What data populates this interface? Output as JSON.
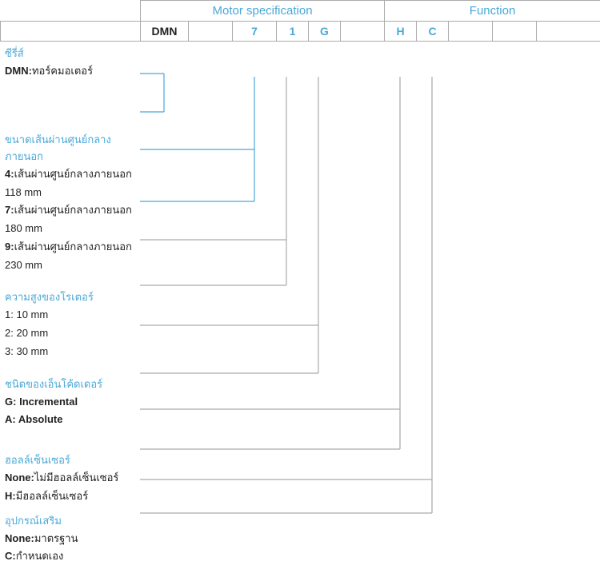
{
  "header": {
    "motor_spec_label": "Motor specification",
    "function_label": "Function",
    "codes": {
      "DMN": "DMN",
      "blank1": "",
      "seven": "7",
      "one": "1",
      "G": "G",
      "blank2": "",
      "H": "H",
      "C": "C",
      "blank3": "",
      "blank4": ""
    }
  },
  "sections": {
    "series": {
      "title": "ซีรี่ส์",
      "items": [
        {
          "label": "DMN:",
          "text": "ทอร์คมอเตอร์"
        }
      ]
    },
    "diameter": {
      "title": "ขนาดเส้นผ่านศูนย์กลางภายนอก",
      "items": [
        {
          "label": "4:",
          "text": "เส้นผ่านศูนย์กลางภายนอก 118 mm"
        },
        {
          "label": "7:",
          "text": "เส้นผ่านศูนย์กลางภายนอก 180 mm"
        },
        {
          "label": "9:",
          "text": "เส้นผ่านศูนย์กลางภายนอก 230 mm"
        }
      ]
    },
    "rotor_height": {
      "title": "ความสูงของโรเตอร์",
      "items": [
        {
          "label": "1:",
          "text": "10 mm"
        },
        {
          "label": "2:",
          "text": "20 mm"
        },
        {
          "label": "3:",
          "text": "30 mm"
        }
      ]
    },
    "encoder": {
      "title": "ชนิดของเอ็นโค้ดเดอร์",
      "items": [
        {
          "label": "G:",
          "text": "Incremental"
        },
        {
          "label": "A:",
          "text": "Absolute"
        }
      ]
    },
    "hall_sensor": {
      "title": "ฮอลล์เซ็นเซอร์",
      "items": [
        {
          "label": "None:",
          "text": "ไม่มีฮอลล์เซ็นเซอร์"
        },
        {
          "label": "H:",
          "text": "มีฮอลล์เซ็นเซอร์"
        }
      ]
    },
    "accessories": {
      "title": "อุปกรณ์เสริม",
      "items": [
        {
          "label": "None:",
          "text": "มาตรฐาน"
        },
        {
          "label": "C:",
          "text": "กำหนดเอง"
        }
      ]
    }
  }
}
